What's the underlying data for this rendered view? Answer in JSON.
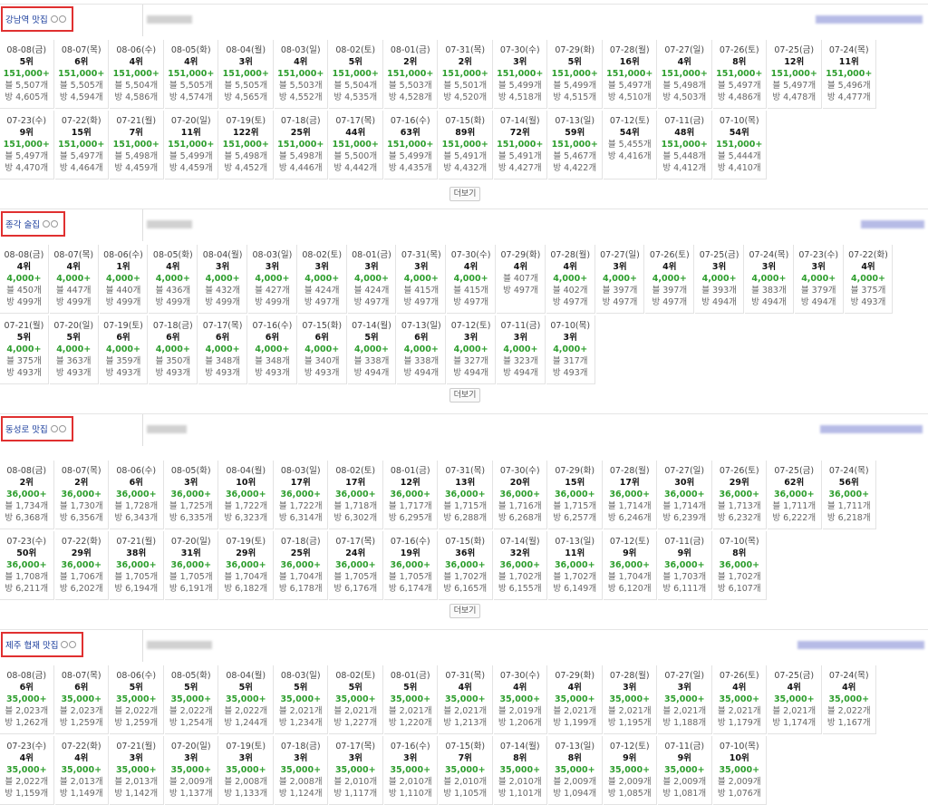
{
  "ui": {
    "more_label": "더보기"
  },
  "sections": [
    {
      "keyword": "강남역 맛집",
      "search_total": "151,000+",
      "rows": [
        [
          {
            "d": "08-08(금)",
            "r": "5위",
            "s": "151,000+",
            "b": "블 5,507개",
            "c": "방 4,605개"
          },
          {
            "d": "08-07(목)",
            "r": "6위",
            "s": "151,000+",
            "b": "블 5,505개",
            "c": "방 4,594개"
          },
          {
            "d": "08-06(수)",
            "r": "4위",
            "s": "151,000+",
            "b": "블 5,504개",
            "c": "방 4,586개"
          },
          {
            "d": "08-05(화)",
            "r": "4위",
            "s": "151,000+",
            "b": "블 5,505개",
            "c": "방 4,574개"
          },
          {
            "d": "08-04(월)",
            "r": "3위",
            "s": "151,000+",
            "b": "블 5,505개",
            "c": "방 4,565개"
          },
          {
            "d": "08-03(일)",
            "r": "4위",
            "s": "151,000+",
            "b": "블 5,503개",
            "c": "방 4,552개"
          },
          {
            "d": "08-02(토)",
            "r": "5위",
            "s": "151,000+",
            "b": "블 5,504개",
            "c": "방 4,535개"
          },
          {
            "d": "08-01(금)",
            "r": "2위",
            "s": "151,000+",
            "b": "블 5,503개",
            "c": "방 4,528개"
          },
          {
            "d": "07-31(목)",
            "r": "2위",
            "s": "151,000+",
            "b": "블 5,501개",
            "c": "방 4,520개"
          },
          {
            "d": "07-30(수)",
            "r": "3위",
            "s": "151,000+",
            "b": "블 5,499개",
            "c": "방 4,518개"
          },
          {
            "d": "07-29(화)",
            "r": "5위",
            "s": "151,000+",
            "b": "블 5,499개",
            "c": "방 4,515개"
          },
          {
            "d": "07-28(월)",
            "r": "16위",
            "s": "151,000+",
            "b": "블 5,497개",
            "c": "방 4,510개"
          },
          {
            "d": "07-27(일)",
            "r": "4위",
            "s": "151,000+",
            "b": "블 5,498개",
            "c": "방 4,503개"
          },
          {
            "d": "07-26(토)",
            "r": "8위",
            "s": "151,000+",
            "b": "블 5,497개",
            "c": "방 4,486개"
          },
          {
            "d": "07-25(금)",
            "r": "12위",
            "s": "151,000+",
            "b": "블 5,497개",
            "c": "방 4,478개"
          },
          {
            "d": "07-24(목)",
            "r": "11위",
            "s": "151,000+",
            "b": "블 5,496개",
            "c": "방 4,477개"
          }
        ],
        [
          {
            "d": "07-23(수)",
            "r": "9위",
            "s": "151,000+",
            "b": "블 5,497개",
            "c": "방 4,470개"
          },
          {
            "d": "07-22(화)",
            "r": "15위",
            "s": "151,000+",
            "b": "블 5,497개",
            "c": "방 4,464개"
          },
          {
            "d": "07-21(월)",
            "r": "7위",
            "s": "151,000+",
            "b": "블 5,498개",
            "c": "방 4,459개"
          },
          {
            "d": "07-20(일)",
            "r": "11위",
            "s": "151,000+",
            "b": "블 5,499개",
            "c": "방 4,459개"
          },
          {
            "d": "07-19(토)",
            "r": "122위",
            "s": "151,000+",
            "b": "블 5,498개",
            "c": "방 4,452개"
          },
          {
            "d": "07-18(금)",
            "r": "25위",
            "s": "151,000+",
            "b": "블 5,498개",
            "c": "방 4,446개"
          },
          {
            "d": "07-17(목)",
            "r": "44위",
            "s": "151,000+",
            "b": "블 5,500개",
            "c": "방 4,442개"
          },
          {
            "d": "07-16(수)",
            "r": "63위",
            "s": "151,000+",
            "b": "블 5,499개",
            "c": "방 4,435개"
          },
          {
            "d": "07-15(화)",
            "r": "89위",
            "s": "151,000+",
            "b": "블 5,491개",
            "c": "방 4,432개"
          },
          {
            "d": "07-14(월)",
            "r": "72위",
            "s": "151,000+",
            "b": "블 5,491개",
            "c": "방 4,427개"
          },
          {
            "d": "07-13(일)",
            "r": "59위",
            "s": "151,000+",
            "b": "블 5,467개",
            "c": "방 4,422개"
          },
          {
            "d": "07-12(토)",
            "r": "54위",
            "s": "",
            "b": "블 5,455개",
            "c": "방 4,416개"
          },
          {
            "d": "07-11(금)",
            "r": "48위",
            "s": "151,000+",
            "b": "블 5,448개",
            "c": "방 4,412개"
          },
          {
            "d": "07-10(목)",
            "r": "54위",
            "s": "151,000+",
            "b": "블 5,444개",
            "c": "방 4,410개"
          }
        ]
      ]
    },
    {
      "keyword": "종각 술집",
      "rows": [
        [
          {
            "d": "08-08(금)",
            "r": "4위",
            "s": "4,000+",
            "b": "블 450개",
            "c": "방 499개"
          },
          {
            "d": "08-07(목)",
            "r": "4위",
            "s": "4,000+",
            "b": "블 447개",
            "c": "방 499개"
          },
          {
            "d": "08-06(수)",
            "r": "1위",
            "s": "4,000+",
            "b": "블 440개",
            "c": "방 499개"
          },
          {
            "d": "08-05(화)",
            "r": "4위",
            "s": "4,000+",
            "b": "블 436개",
            "c": "방 499개"
          },
          {
            "d": "08-04(월)",
            "r": "3위",
            "s": "4,000+",
            "b": "블 432개",
            "c": "방 499개"
          },
          {
            "d": "08-03(일)",
            "r": "3위",
            "s": "4,000+",
            "b": "블 427개",
            "c": "방 499개"
          },
          {
            "d": "08-02(토)",
            "r": "3위",
            "s": "4,000+",
            "b": "블 424개",
            "c": "방 497개"
          },
          {
            "d": "08-01(금)",
            "r": "3위",
            "s": "4,000+",
            "b": "블 424개",
            "c": "방 497개"
          },
          {
            "d": "07-31(목)",
            "r": "3위",
            "s": "4,000+",
            "b": "블 415개",
            "c": "방 497개"
          },
          {
            "d": "07-30(수)",
            "r": "4위",
            "s": "4,000+",
            "b": "블 415개",
            "c": "방 497개"
          },
          {
            "d": "07-29(화)",
            "r": "4위",
            "s": "",
            "b": "블 407개",
            "c": "방 497개"
          },
          {
            "d": "07-28(월)",
            "r": "4위",
            "s": "4,000+",
            "b": "블 402개",
            "c": "방 497개"
          },
          {
            "d": "07-27(일)",
            "r": "3위",
            "s": "4,000+",
            "b": "블 397개",
            "c": "방 497개"
          },
          {
            "d": "07-26(토)",
            "r": "4위",
            "s": "4,000+",
            "b": "블 397개",
            "c": "방 497개"
          },
          {
            "d": "07-25(금)",
            "r": "3위",
            "s": "4,000+",
            "b": "블 393개",
            "c": "방 494개"
          },
          {
            "d": "07-24(목)",
            "r": "3위",
            "s": "4,000+",
            "b": "블 383개",
            "c": "방 494개"
          },
          {
            "d": "07-23(수)",
            "r": "3위",
            "s": "4,000+",
            "b": "블 379개",
            "c": "방 494개"
          },
          {
            "d": "07-22(화)",
            "r": "4위",
            "s": "4,000+",
            "b": "블 375개",
            "c": "방 493개"
          }
        ],
        [
          {
            "d": "07-21(월)",
            "r": "5위",
            "s": "4,000+",
            "b": "블 375개",
            "c": "방 493개"
          },
          {
            "d": "07-20(일)",
            "r": "5위",
            "s": "4,000+",
            "b": "블 363개",
            "c": "방 493개"
          },
          {
            "d": "07-19(토)",
            "r": "6위",
            "s": "4,000+",
            "b": "블 359개",
            "c": "방 493개"
          },
          {
            "d": "07-18(금)",
            "r": "6위",
            "s": "4,000+",
            "b": "블 350개",
            "c": "방 493개"
          },
          {
            "d": "07-17(목)",
            "r": "6위",
            "s": "4,000+",
            "b": "블 348개",
            "c": "방 493개"
          },
          {
            "d": "07-16(수)",
            "r": "6위",
            "s": "4,000+",
            "b": "블 348개",
            "c": "방 493개"
          },
          {
            "d": "07-15(화)",
            "r": "6위",
            "s": "4,000+",
            "b": "블 340개",
            "c": "방 493개"
          },
          {
            "d": "07-14(월)",
            "r": "5위",
            "s": "4,000+",
            "b": "블 338개",
            "c": "방 494개"
          },
          {
            "d": "07-13(일)",
            "r": "6위",
            "s": "4,000+",
            "b": "블 338개",
            "c": "방 494개"
          },
          {
            "d": "07-12(토)",
            "r": "3위",
            "s": "4,000+",
            "b": "블 327개",
            "c": "방 494개"
          },
          {
            "d": "07-11(금)",
            "r": "3위",
            "s": "4,000+",
            "b": "블 323개",
            "c": "방 494개"
          },
          {
            "d": "07-10(목)",
            "r": "3위",
            "s": "4,000+",
            "b": "블 317개",
            "c": "방 493개"
          }
        ]
      ]
    },
    {
      "keyword": "동성로 맛집",
      "rows": [
        [
          {
            "d": "08-08(금)",
            "r": "2위",
            "s": "36,000+",
            "b": "블 1,734개",
            "c": "방 6,368개"
          },
          {
            "d": "08-07(목)",
            "r": "2위",
            "s": "36,000+",
            "b": "블 1,730개",
            "c": "방 6,356개"
          },
          {
            "d": "08-06(수)",
            "r": "6위",
            "s": "36,000+",
            "b": "블 1,728개",
            "c": "방 6,343개"
          },
          {
            "d": "08-05(화)",
            "r": "3위",
            "s": "36,000+",
            "b": "블 1,725개",
            "c": "방 6,335개"
          },
          {
            "d": "08-04(월)",
            "r": "10위",
            "s": "36,000+",
            "b": "블 1,722개",
            "c": "방 6,323개"
          },
          {
            "d": "08-03(일)",
            "r": "17위",
            "s": "36,000+",
            "b": "블 1,722개",
            "c": "방 6,314개"
          },
          {
            "d": "08-02(토)",
            "r": "17위",
            "s": "36,000+",
            "b": "블 1,718개",
            "c": "방 6,302개"
          },
          {
            "d": "08-01(금)",
            "r": "12위",
            "s": "36,000+",
            "b": "블 1,717개",
            "c": "방 6,295개"
          },
          {
            "d": "07-31(목)",
            "r": "13위",
            "s": "36,000+",
            "b": "블 1,715개",
            "c": "방 6,288개"
          },
          {
            "d": "07-30(수)",
            "r": "20위",
            "s": "36,000+",
            "b": "블 1,716개",
            "c": "방 6,268개"
          },
          {
            "d": "07-29(화)",
            "r": "15위",
            "s": "36,000+",
            "b": "블 1,715개",
            "c": "방 6,257개"
          },
          {
            "d": "07-28(월)",
            "r": "17위",
            "s": "36,000+",
            "b": "블 1,714개",
            "c": "방 6,246개"
          },
          {
            "d": "07-27(일)",
            "r": "30위",
            "s": "36,000+",
            "b": "블 1,714개",
            "c": "방 6,239개"
          },
          {
            "d": "07-26(토)",
            "r": "29위",
            "s": "36,000+",
            "b": "블 1,713개",
            "c": "방 6,232개"
          },
          {
            "d": "07-25(금)",
            "r": "62위",
            "s": "36,000+",
            "b": "블 1,711개",
            "c": "방 6,222개"
          },
          {
            "d": "07-24(목)",
            "r": "56위",
            "s": "36,000+",
            "b": "블 1,711개",
            "c": "방 6,218개"
          }
        ],
        [
          {
            "d": "07-23(수)",
            "r": "50위",
            "s": "36,000+",
            "b": "블 1,708개",
            "c": "방 6,211개"
          },
          {
            "d": "07-22(화)",
            "r": "29위",
            "s": "36,000+",
            "b": "블 1,706개",
            "c": "방 6,202개"
          },
          {
            "d": "07-21(월)",
            "r": "38위",
            "s": "36,000+",
            "b": "블 1,705개",
            "c": "방 6,194개"
          },
          {
            "d": "07-20(일)",
            "r": "31위",
            "s": "36,000+",
            "b": "블 1,705개",
            "c": "방 6,191개"
          },
          {
            "d": "07-19(토)",
            "r": "29위",
            "s": "36,000+",
            "b": "블 1,704개",
            "c": "방 6,182개"
          },
          {
            "d": "07-18(금)",
            "r": "25위",
            "s": "36,000+",
            "b": "블 1,704개",
            "c": "방 6,178개"
          },
          {
            "d": "07-17(목)",
            "r": "24위",
            "s": "36,000+",
            "b": "블 1,705개",
            "c": "방 6,176개"
          },
          {
            "d": "07-16(수)",
            "r": "19위",
            "s": "36,000+",
            "b": "블 1,705개",
            "c": "방 6,174개"
          },
          {
            "d": "07-15(화)",
            "r": "36위",
            "s": "36,000+",
            "b": "블 1,702개",
            "c": "방 6,165개"
          },
          {
            "d": "07-14(월)",
            "r": "32위",
            "s": "36,000+",
            "b": "블 1,702개",
            "c": "방 6,155개"
          },
          {
            "d": "07-13(일)",
            "r": "11위",
            "s": "36,000+",
            "b": "블 1,702개",
            "c": "방 6,149개"
          },
          {
            "d": "07-12(토)",
            "r": "9위",
            "s": "36,000+",
            "b": "블 1,704개",
            "c": "방 6,120개"
          },
          {
            "d": "07-11(금)",
            "r": "9위",
            "s": "36,000+",
            "b": "블 1,703개",
            "c": "방 6,111개"
          },
          {
            "d": "07-10(목)",
            "r": "8위",
            "s": "36,000+",
            "b": "블 1,702개",
            "c": "방 6,107개"
          }
        ]
      ]
    },
    {
      "keyword": "제주 협재 맛집",
      "rows": [
        [
          {
            "d": "08-08(금)",
            "r": "6위",
            "s": "35,000+",
            "b": "블 2,023개",
            "c": "방 1,262개"
          },
          {
            "d": "08-07(목)",
            "r": "6위",
            "s": "35,000+",
            "b": "블 2,023개",
            "c": "방 1,259개"
          },
          {
            "d": "08-06(수)",
            "r": "5위",
            "s": "35,000+",
            "b": "블 2,022개",
            "c": "방 1,259개"
          },
          {
            "d": "08-05(화)",
            "r": "5위",
            "s": "35,000+",
            "b": "블 2,022개",
            "c": "방 1,254개"
          },
          {
            "d": "08-04(월)",
            "r": "5위",
            "s": "35,000+",
            "b": "블 2,022개",
            "c": "방 1,244개"
          },
          {
            "d": "08-03(일)",
            "r": "5위",
            "s": "35,000+",
            "b": "블 2,021개",
            "c": "방 1,234개"
          },
          {
            "d": "08-02(토)",
            "r": "5위",
            "s": "35,000+",
            "b": "블 2,021개",
            "c": "방 1,227개"
          },
          {
            "d": "08-01(금)",
            "r": "5위",
            "s": "35,000+",
            "b": "블 2,021개",
            "c": "방 1,220개"
          },
          {
            "d": "07-31(목)",
            "r": "4위",
            "s": "35,000+",
            "b": "블 2,021개",
            "c": "방 1,213개"
          },
          {
            "d": "07-30(수)",
            "r": "4위",
            "s": "35,000+",
            "b": "블 2,019개",
            "c": "방 1,206개"
          },
          {
            "d": "07-29(화)",
            "r": "4위",
            "s": "35,000+",
            "b": "블 2,021개",
            "c": "방 1,199개"
          },
          {
            "d": "07-28(월)",
            "r": "3위",
            "s": "35,000+",
            "b": "블 2,021개",
            "c": "방 1,195개"
          },
          {
            "d": "07-27(일)",
            "r": "3위",
            "s": "35,000+",
            "b": "블 2,021개",
            "c": "방 1,188개"
          },
          {
            "d": "07-26(토)",
            "r": "4위",
            "s": "35,000+",
            "b": "블 2,021개",
            "c": "방 1,179개"
          },
          {
            "d": "07-25(금)",
            "r": "4위",
            "s": "35,000+",
            "b": "블 2,021개",
            "c": "방 1,174개"
          },
          {
            "d": "07-24(목)",
            "r": "4위",
            "s": "35,000+",
            "b": "블 2,022개",
            "c": "방 1,167개"
          }
        ],
        [
          {
            "d": "07-23(수)",
            "r": "4위",
            "s": "35,000+",
            "b": "블 2,022개",
            "c": "방 1,159개"
          },
          {
            "d": "07-22(화)",
            "r": "4위",
            "s": "35,000+",
            "b": "블 2,013개",
            "c": "방 1,149개"
          },
          {
            "d": "07-21(월)",
            "r": "3위",
            "s": "35,000+",
            "b": "블 2,013개",
            "c": "방 1,142개"
          },
          {
            "d": "07-20(일)",
            "r": "3위",
            "s": "35,000+",
            "b": "블 2,009개",
            "c": "방 1,137개"
          },
          {
            "d": "07-19(토)",
            "r": "3위",
            "s": "35,000+",
            "b": "블 2,008개",
            "c": "방 1,133개"
          },
          {
            "d": "07-18(금)",
            "r": "3위",
            "s": "35,000+",
            "b": "블 2,008개",
            "c": "방 1,124개"
          },
          {
            "d": "07-17(목)",
            "r": "3위",
            "s": "35,000+",
            "b": "블 2,010개",
            "c": "방 1,117개"
          },
          {
            "d": "07-16(수)",
            "r": "3위",
            "s": "35,000+",
            "b": "블 2,010개",
            "c": "방 1,110개"
          },
          {
            "d": "07-15(화)",
            "r": "7위",
            "s": "35,000+",
            "b": "블 2,010개",
            "c": "방 1,105개"
          },
          {
            "d": "07-14(월)",
            "r": "8위",
            "s": "35,000+",
            "b": "블 2,010개",
            "c": "방 1,101개"
          },
          {
            "d": "07-13(일)",
            "r": "8위",
            "s": "35,000+",
            "b": "블 2,009개",
            "c": "방 1,094개"
          },
          {
            "d": "07-12(토)",
            "r": "9위",
            "s": "35,000+",
            "b": "블 2,009개",
            "c": "방 1,085개"
          },
          {
            "d": "07-11(금)",
            "r": "9위",
            "s": "35,000+",
            "b": "블 2,009개",
            "c": "방 1,081개"
          },
          {
            "d": "07-10(목)",
            "r": "10위",
            "s": "35,000+",
            "b": "블 2,009개",
            "c": "방 1,076개"
          }
        ]
      ]
    }
  ]
}
